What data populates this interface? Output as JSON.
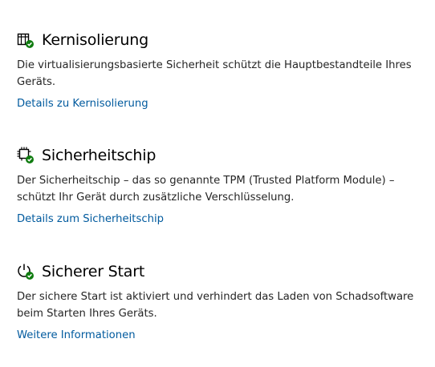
{
  "sections": [
    {
      "icon": "core-isolation-icon",
      "title": "Kernisolierung",
      "description": "Die virtualisierungsbasierte Sicherheit schützt die Hauptbestandteile Ihres Geräts.",
      "link": "Details zu Kernisolierung"
    },
    {
      "icon": "security-chip-icon",
      "title": "Sicherheitschip",
      "description": "Der Sicherheitschip – das so genannte TPM (Trusted Platform Module) – schützt Ihr Gerät durch zusätzliche Verschlüsselung.",
      "link": "Details zum Sicherheitschip"
    },
    {
      "icon": "secure-boot-icon",
      "title": "Sicherer Start",
      "description": "Der sichere Start ist aktiviert und verhindert das Laden von Schadsoftware beim Starten Ihres Geräts.",
      "link": "Weitere Informationen"
    }
  ],
  "colors": {
    "link": "#005a9e",
    "status_ok": "#107c10",
    "icon_stroke": "#000000"
  }
}
